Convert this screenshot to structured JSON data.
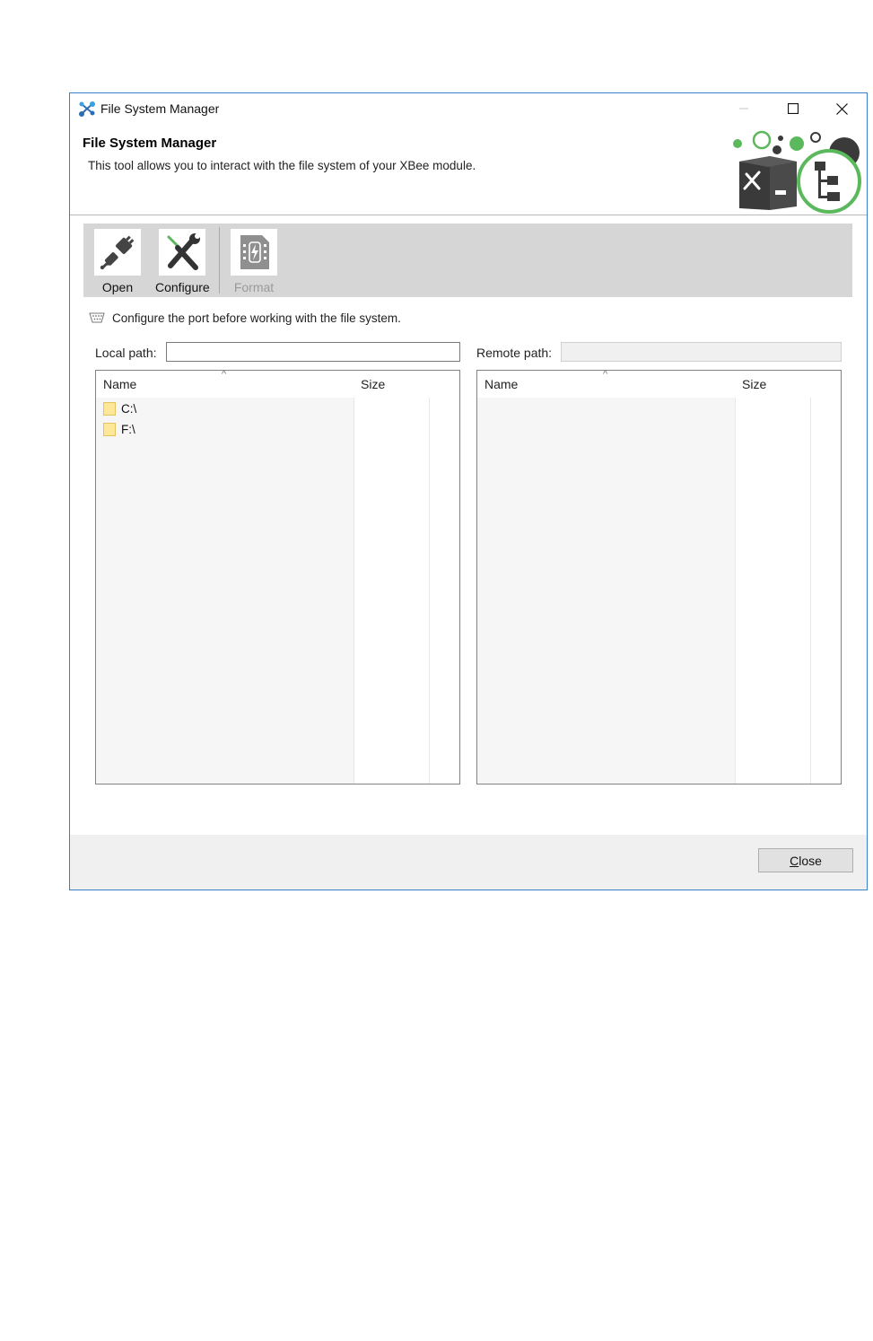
{
  "window": {
    "title": "File System Manager",
    "controls": {
      "minimize": "—",
      "maximize": "☐",
      "close": "✕"
    }
  },
  "header": {
    "title": "File System Manager",
    "description": "This tool allows you to interact with the file system of your XBee module."
  },
  "toolbar": {
    "open_label": "Open",
    "configure_label": "Configure",
    "format_label": "Format",
    "format_enabled": false
  },
  "status": {
    "message": "Configure the port before working with the file system."
  },
  "local": {
    "path_label": "Local path:",
    "path_value": "",
    "columns": {
      "name": "Name",
      "size": "Size"
    },
    "items": [
      {
        "name": "C:\\",
        "size": ""
      },
      {
        "name": "F:\\",
        "size": ""
      }
    ]
  },
  "remote": {
    "path_label": "Remote path:",
    "path_value": "",
    "path_enabled": false,
    "columns": {
      "name": "Name",
      "size": "Size"
    },
    "items": []
  },
  "footer": {
    "close_label": "Close",
    "close_mnemonic": "C"
  },
  "colors": {
    "window_border": "#3c7fc9",
    "toolbar_bg": "#d6d6d6",
    "accent_green": "#5cb85c",
    "folder_yellow": "#ffe79a"
  },
  "icons": {
    "app": "network-nodes-icon",
    "open": "plug-connector-icon",
    "configure": "wrench-screwdriver-icon",
    "format": "memory-chip-icon",
    "status": "serial-port-icon",
    "folder": "folder-icon"
  }
}
